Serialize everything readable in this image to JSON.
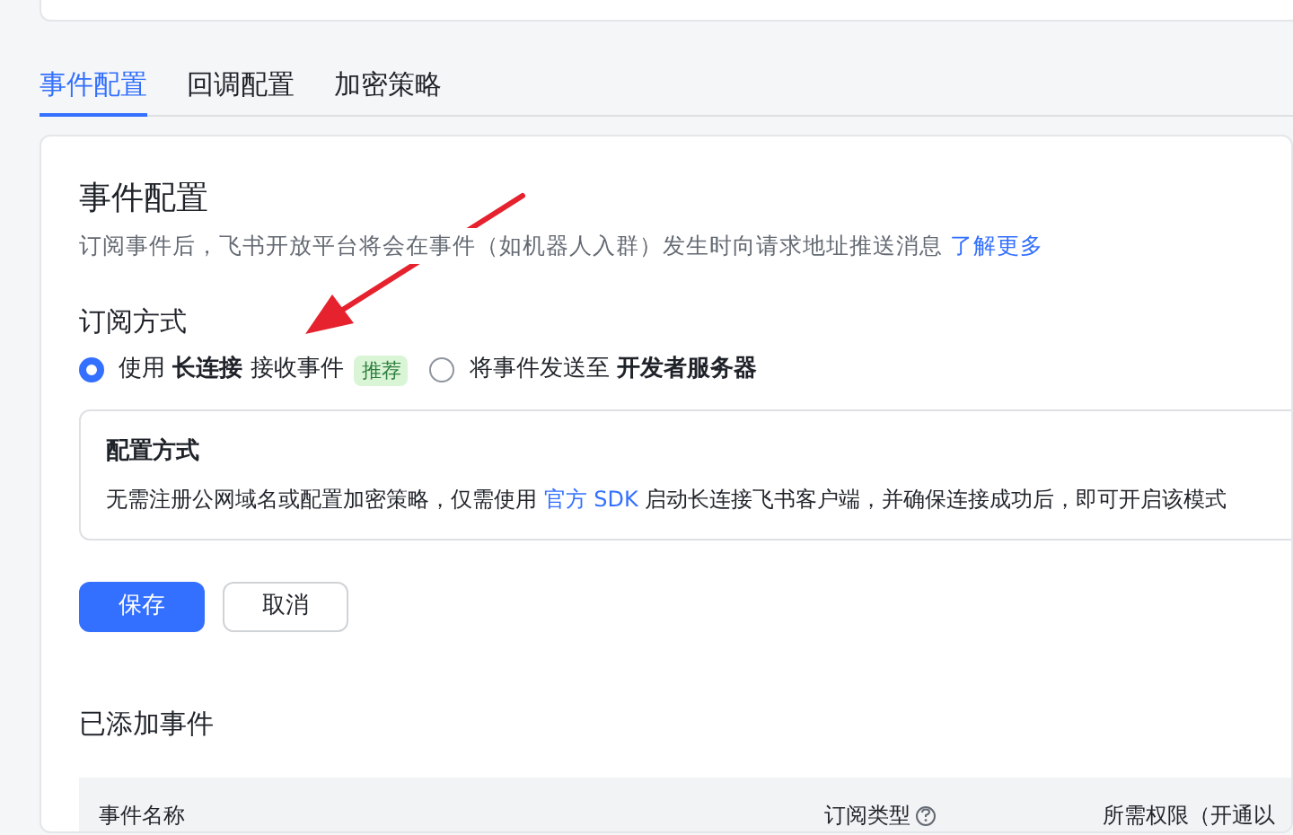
{
  "tabs": [
    {
      "label": "事件配置",
      "selected": true
    },
    {
      "label": "回调配置",
      "selected": false
    },
    {
      "label": "加密策略",
      "selected": false
    }
  ],
  "section": {
    "title": "事件配置",
    "description": {
      "text": "订阅事件后，飞书开放平台将会在事件（如机器人入群）发生时向请求地址推送消息",
      "link": "了解更多"
    }
  },
  "subscription": {
    "title": "订阅方式",
    "options": [
      {
        "label": "使用 **长连接** 接收事件",
        "badge": "推荐",
        "selected": true
      },
      {
        "label": "将事件发送至 **开发者服务器**",
        "selected": false
      }
    ],
    "config": {
      "title": "配置方式",
      "text_before": "无需注册公网域名或配置加密策略，仅需使用",
      "link": "官方 SDK",
      "text_after": "启动长连接飞书客户端，并确保连接成功后，即可开启该模式"
    }
  },
  "buttons": [
    {
      "label": "保存",
      "kind": "primary"
    },
    {
      "label": "取消",
      "kind": "secondary"
    }
  ],
  "added_events": {
    "title": "已添加事件",
    "columns": [
      {
        "label": "事件名称",
        "help": false
      },
      {
        "label": "订阅类型",
        "help": true
      },
      {
        "label": "所需权限（开通以",
        "help": false
      }
    ]
  }
}
